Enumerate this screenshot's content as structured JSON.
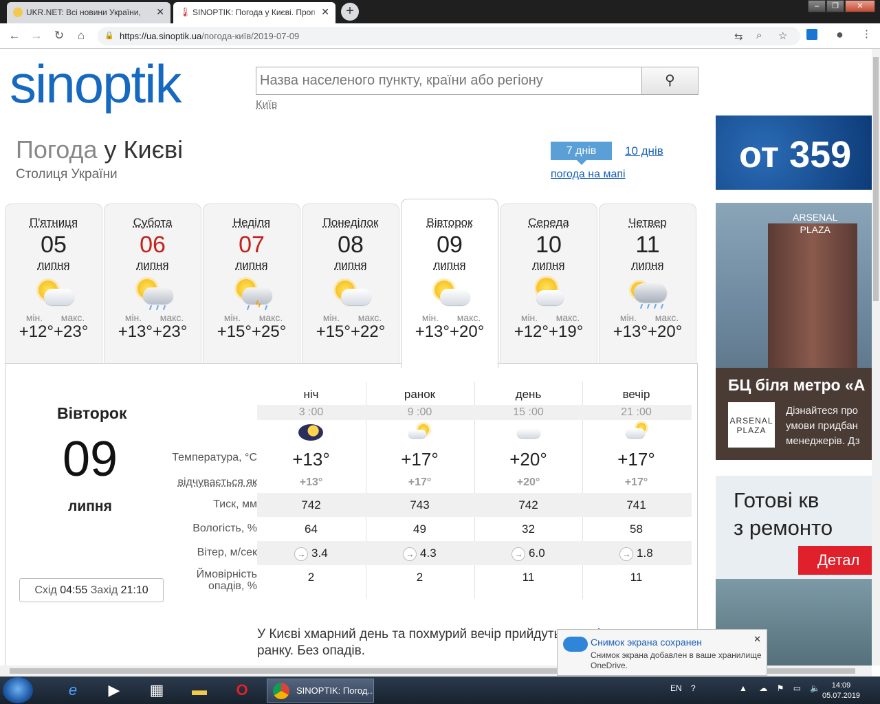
{
  "browser": {
    "tabs": [
      {
        "title": "UKR.NET: Всі новини України, ос",
        "active": false
      },
      {
        "title": "SINOPTIK: Погода у Києві. Прогн",
        "active": true
      }
    ],
    "url_domain": "https://ua.sinoptik.ua",
    "url_path": "/погода-київ/2019-07-09"
  },
  "site": {
    "logo_text": "sinoptik",
    "search_placeholder": "Назва населеного пункту, країни або регіону",
    "search_hint": "Київ"
  },
  "header": {
    "title_prefix": "Погода",
    "title_main": " у Києві",
    "subtitle": "Столиця України",
    "btn_7days": "7 днів",
    "btn_10days": "10 днів",
    "map_link": "погода на мапі"
  },
  "days": [
    {
      "name": "П'ятниця",
      "date": "05",
      "month": "липня",
      "min_label": "мін.",
      "max_label": "макс.",
      "min": "+12°",
      "max": "+23°",
      "icon": "sun-cloud-icon",
      "weekend": false
    },
    {
      "name": "Субота",
      "date": "06",
      "month": "липня",
      "min_label": "мін.",
      "max_label": "макс.",
      "min": "+13°",
      "max": "+23°",
      "icon": "sun-cloud-rain-icon",
      "weekend": true
    },
    {
      "name": "Неділя",
      "date": "07",
      "month": "липня",
      "min_label": "мін.",
      "max_label": "макс.",
      "min": "+15°",
      "max": "+25°",
      "icon": "thunderstorm-icon",
      "weekend": true
    },
    {
      "name": "Понеділок",
      "date": "08",
      "month": "липня",
      "min_label": "мін.",
      "max_label": "макс.",
      "min": "+15°",
      "max": "+22°",
      "icon": "sun-cloud-icon",
      "weekend": false
    },
    {
      "name": "Вівторок",
      "date": "09",
      "month": "липня",
      "min_label": "мін.",
      "max_label": "макс.",
      "min": "+13°",
      "max": "+20°",
      "icon": "sun-cloud-icon",
      "weekend": false,
      "active": true
    },
    {
      "name": "Середа",
      "date": "10",
      "month": "липня",
      "min_label": "мін.",
      "max_label": "макс.",
      "min": "+12°",
      "max": "+19°",
      "icon": "sun-cloud-icon",
      "weekend": false
    },
    {
      "name": "Четвер",
      "date": "11",
      "month": "липня",
      "min_label": "мін.",
      "max_label": "макс.",
      "min": "+13°",
      "max": "+20°",
      "icon": "cloud-rain-icon",
      "weekend": false
    }
  ],
  "detail": {
    "day_name": "Вівторок",
    "date": "09",
    "month": "липня",
    "sunrise_label": "Схід",
    "sunrise": "04:55",
    "sunset_label": "Захід",
    "sunset": "21:10",
    "periods": [
      "ніч",
      "ранок",
      "день",
      "вечір"
    ],
    "times": [
      "3 :00",
      "9 :00",
      "15 :00",
      "21 :00"
    ],
    "icons": [
      "moon-icon",
      "sun-cloud-icon",
      "cloud-icon",
      "sun-cloud-icon"
    ],
    "rows": {
      "temp_label": "Температура, °C",
      "temp": [
        "+13°",
        "+17°",
        "+20°",
        "+17°"
      ],
      "feels_label": "відчувається як",
      "feels": [
        "+13°",
        "+17°",
        "+20°",
        "+17°"
      ],
      "pressure_label": "Тиск, мм",
      "pressure": [
        "742",
        "743",
        "742",
        "741"
      ],
      "humidity_label": "Вологість, %",
      "humidity": [
        "64",
        "49",
        "32",
        "58"
      ],
      "wind_label": "Вітер, м/сек",
      "wind": [
        "3.4",
        "4.3",
        "6.0",
        "1.8"
      ],
      "precip_label_1": "Ймовірність",
      "precip_label_2": "опадів, %",
      "precip": [
        "2",
        "2",
        "11",
        "11"
      ]
    },
    "description": "У Києві хмарний день та похмурий вечір прийдуть на зміну ясному ранку. Без опадів."
  },
  "ads": {
    "ad1_text": "от 359",
    "ad2_brand_1": "ARSENAL",
    "ad2_brand_2": "PLAZA",
    "ad2_headline": "БЦ біля метро «А",
    "ad2_logo_1": "ARSENAL",
    "ad2_logo_2": "PLAZA",
    "ad2_line1": "Дізнайтеся про",
    "ad2_line2": "умови придбан",
    "ad2_line3": "менеджерів. Дз",
    "ad3_line1": "Готові кв",
    "ad3_line2": "з ремонто",
    "ad3_btn": "Детал"
  },
  "notification": {
    "title": "Снимок экрана сохранен",
    "body": "Снимок экрана добавлен в ваше хранилище OneDrive."
  },
  "taskbar": {
    "chrome_label": "SINOPTIK: Погод...",
    "lang": "EN",
    "time": "14:09",
    "date": "05.07.2019"
  }
}
